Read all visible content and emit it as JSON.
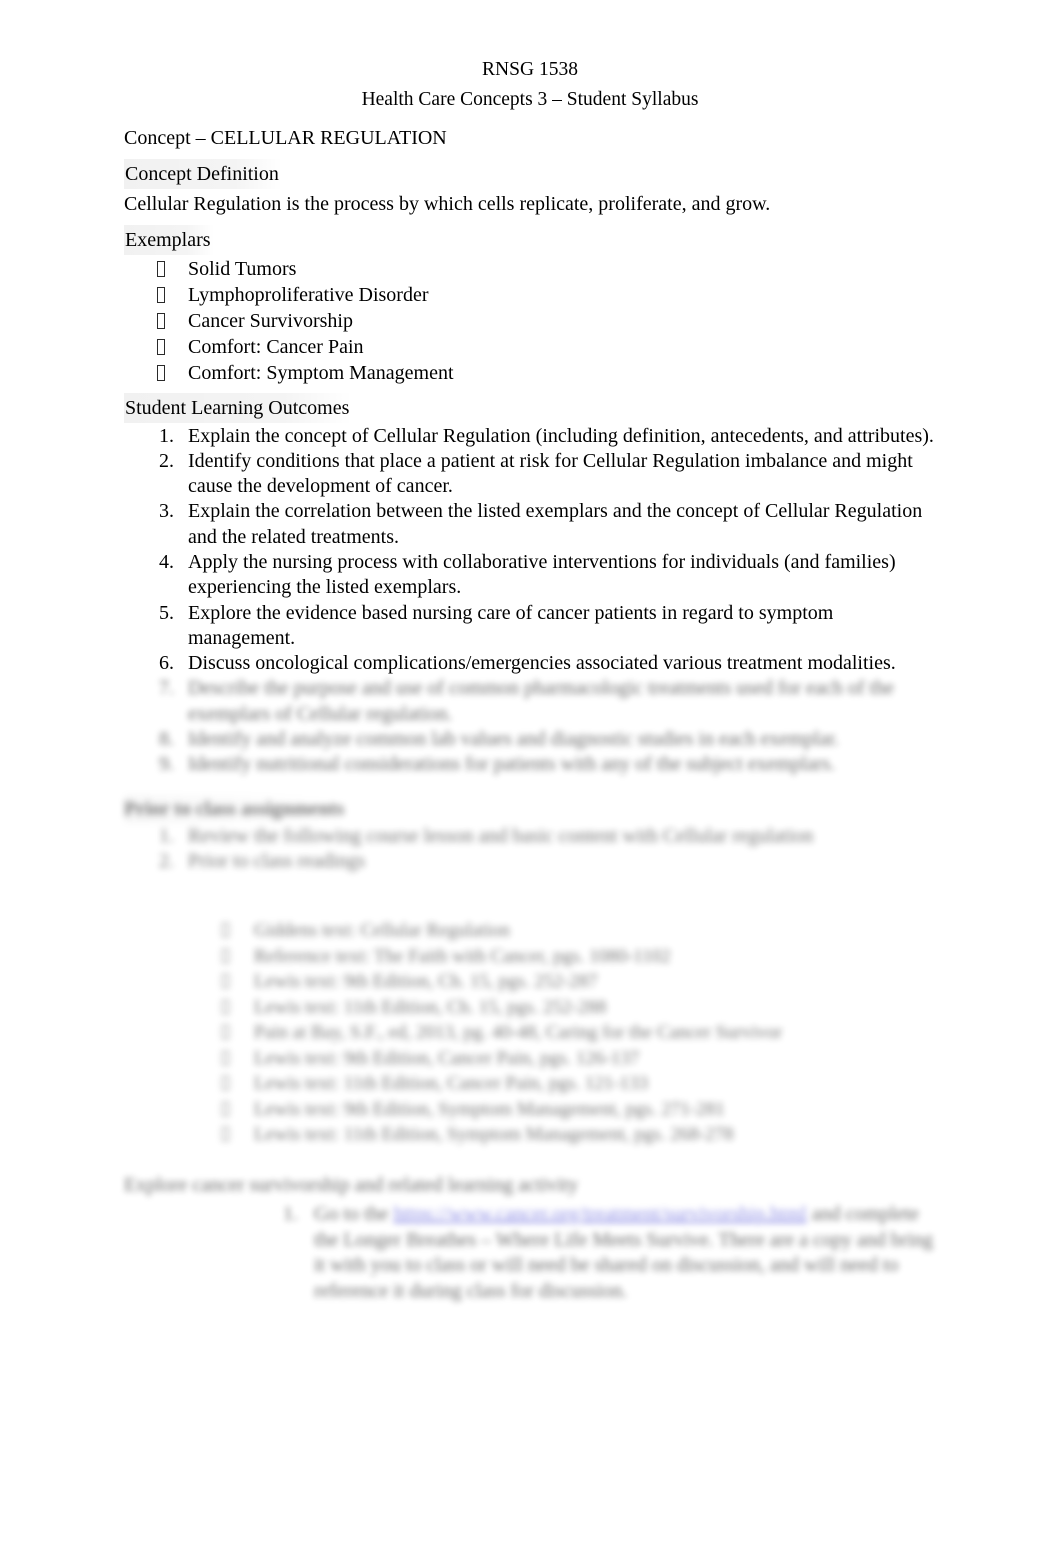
{
  "document": {
    "header": {
      "course_code": "RNSG 1538",
      "course_title": "Health Care Concepts 3 – Student Syllabus"
    },
    "concept_title": "Concept – CELLULAR REGULATION",
    "sections": {
      "concept_definition": {
        "heading": "Concept Definition",
        "body": "Cellular Regulation is the process by which cells replicate, proliferate, and grow."
      },
      "exemplars": {
        "heading": "Exemplars",
        "bullet_glyph": "missing-glyph-box",
        "items": [
          "Solid Tumors",
          "Lymphoproliferative Disorder",
          "Cancer Survivorship",
          "Comfort:  Cancer Pain",
          "Comfort:  Symptom Management"
        ]
      },
      "student_learning_outcomes": {
        "heading": "Student Learning Outcomes",
        "items": [
          {
            "number": "1.",
            "text": "Explain the concept of Cellular Regulation (including definition, antecedents, and attributes)."
          },
          {
            "number": "2.",
            "text": "Identify conditions that place a patient at risk for Cellular Regulation imbalance and might cause the development of cancer."
          },
          {
            "number": "3.",
            "text": "Explain the correlation between the listed exemplars and the concept of Cellular Regulation and the related treatments."
          },
          {
            "number": "4.",
            "text": "Apply the nursing process with collaborative interventions for individuals (and families) experiencing the listed exemplars."
          },
          {
            "number": "5.",
            "text": "Explore the evidence based nursing care of cancer patients in regard to symptom management."
          },
          {
            "number": "6.",
            "text": "Discuss oncological complications/emergencies associated various treatment modalities."
          }
        ],
        "redacted_items": [
          {
            "number": "7.",
            "text": "Describe the purpose and use of common pharmacologic treatments used for each of the exemplars of Cellular regulation."
          },
          {
            "number": "8.",
            "text": "Identify and analyze common lab values and diagnostic studies in each exemplar."
          },
          {
            "number": "9.",
            "text": "Identify nutritional considerations for patients with any of the subject exemplars."
          }
        ]
      },
      "prior_to_class": {
        "heading": "Prior to class assignments",
        "items": [
          {
            "number": "1.",
            "text": "Review the following course lesson and basic content with Cellular regulation"
          },
          {
            "number": "2.",
            "text": "Prior to class readings"
          }
        ],
        "readings": [
          "Giddens text: Cellular Regulation",
          "Reference text: The Faith with Cancer, pgs. 1080-1102",
          "Lewis text: 9th Edition, Ch. 15, pgs. 252-287",
          "Lewis text: 11th Edition, Ch. 15, pgs. 252-288",
          "Pain at Bay, S.F., ed, 2013, pg. 40-48, Caring for the Cancer Survivor",
          "Lewis text: 9th Edition, Cancer Pain, pgs. 126-137",
          "Lewis text: 11th Edition, Cancer Pain, pgs. 121-133",
          "Lewis text: 9th Edition, Symptom Management, pgs. 271-281",
          "Lewis text: 11th Edition, Symptom Management, pgs. 268-278"
        ]
      },
      "discussion": {
        "heading": "Explore cancer survivorship and related learning activity",
        "item_number": "1.",
        "text_before_link": "Go to the ",
        "link_text": "https://www.cancer.org/treatment/survivorship.html",
        "text_after_link": " and complete the Longer Breathes – Where Life Meets Survive. There are a copy and bring it with you to class or will need be shared on discussion, and will need to reference it during class for discussion."
      }
    }
  }
}
